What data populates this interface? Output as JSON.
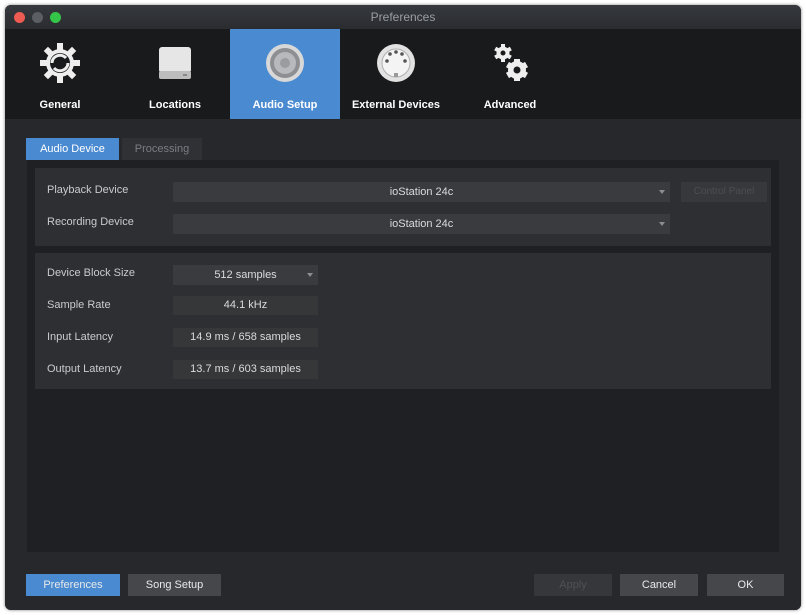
{
  "window": {
    "title": "Preferences"
  },
  "toolbar": {
    "items": [
      {
        "label": "General",
        "icon": "gear-icon"
      },
      {
        "label": "Locations",
        "icon": "drive-icon"
      },
      {
        "label": "Audio Setup",
        "icon": "speaker-icon"
      },
      {
        "label": "External Devices",
        "icon": "midi-connector-icon"
      },
      {
        "label": "Advanced",
        "icon": "gears-icon"
      }
    ],
    "active": "Audio Setup"
  },
  "tabs": [
    {
      "label": "Audio Device",
      "active": true
    },
    {
      "label": "Processing",
      "active": false
    }
  ],
  "devices": {
    "playback_label": "Playback Device",
    "playback_value": "ioStation 24c",
    "control_panel_label": "Control Panel",
    "recording_label": "Recording Device",
    "recording_value": "ioStation 24c"
  },
  "settings": {
    "block_size_label": "Device Block Size",
    "block_size_value": "512 samples",
    "sample_rate_label": "Sample Rate",
    "sample_rate_value": "44.1 kHz",
    "input_latency_label": "Input Latency",
    "input_latency_value": "14.9 ms / 658 samples",
    "output_latency_label": "Output Latency",
    "output_latency_value": "13.7 ms / 603 samples"
  },
  "footer": {
    "preferences_label": "Preferences",
    "song_setup_label": "Song Setup",
    "apply_label": "Apply",
    "cancel_label": "Cancel",
    "ok_label": "OK"
  },
  "colors": {
    "accent": "#4a8ad1",
    "background": "#26282b",
    "toolbar": "#191a1c"
  }
}
